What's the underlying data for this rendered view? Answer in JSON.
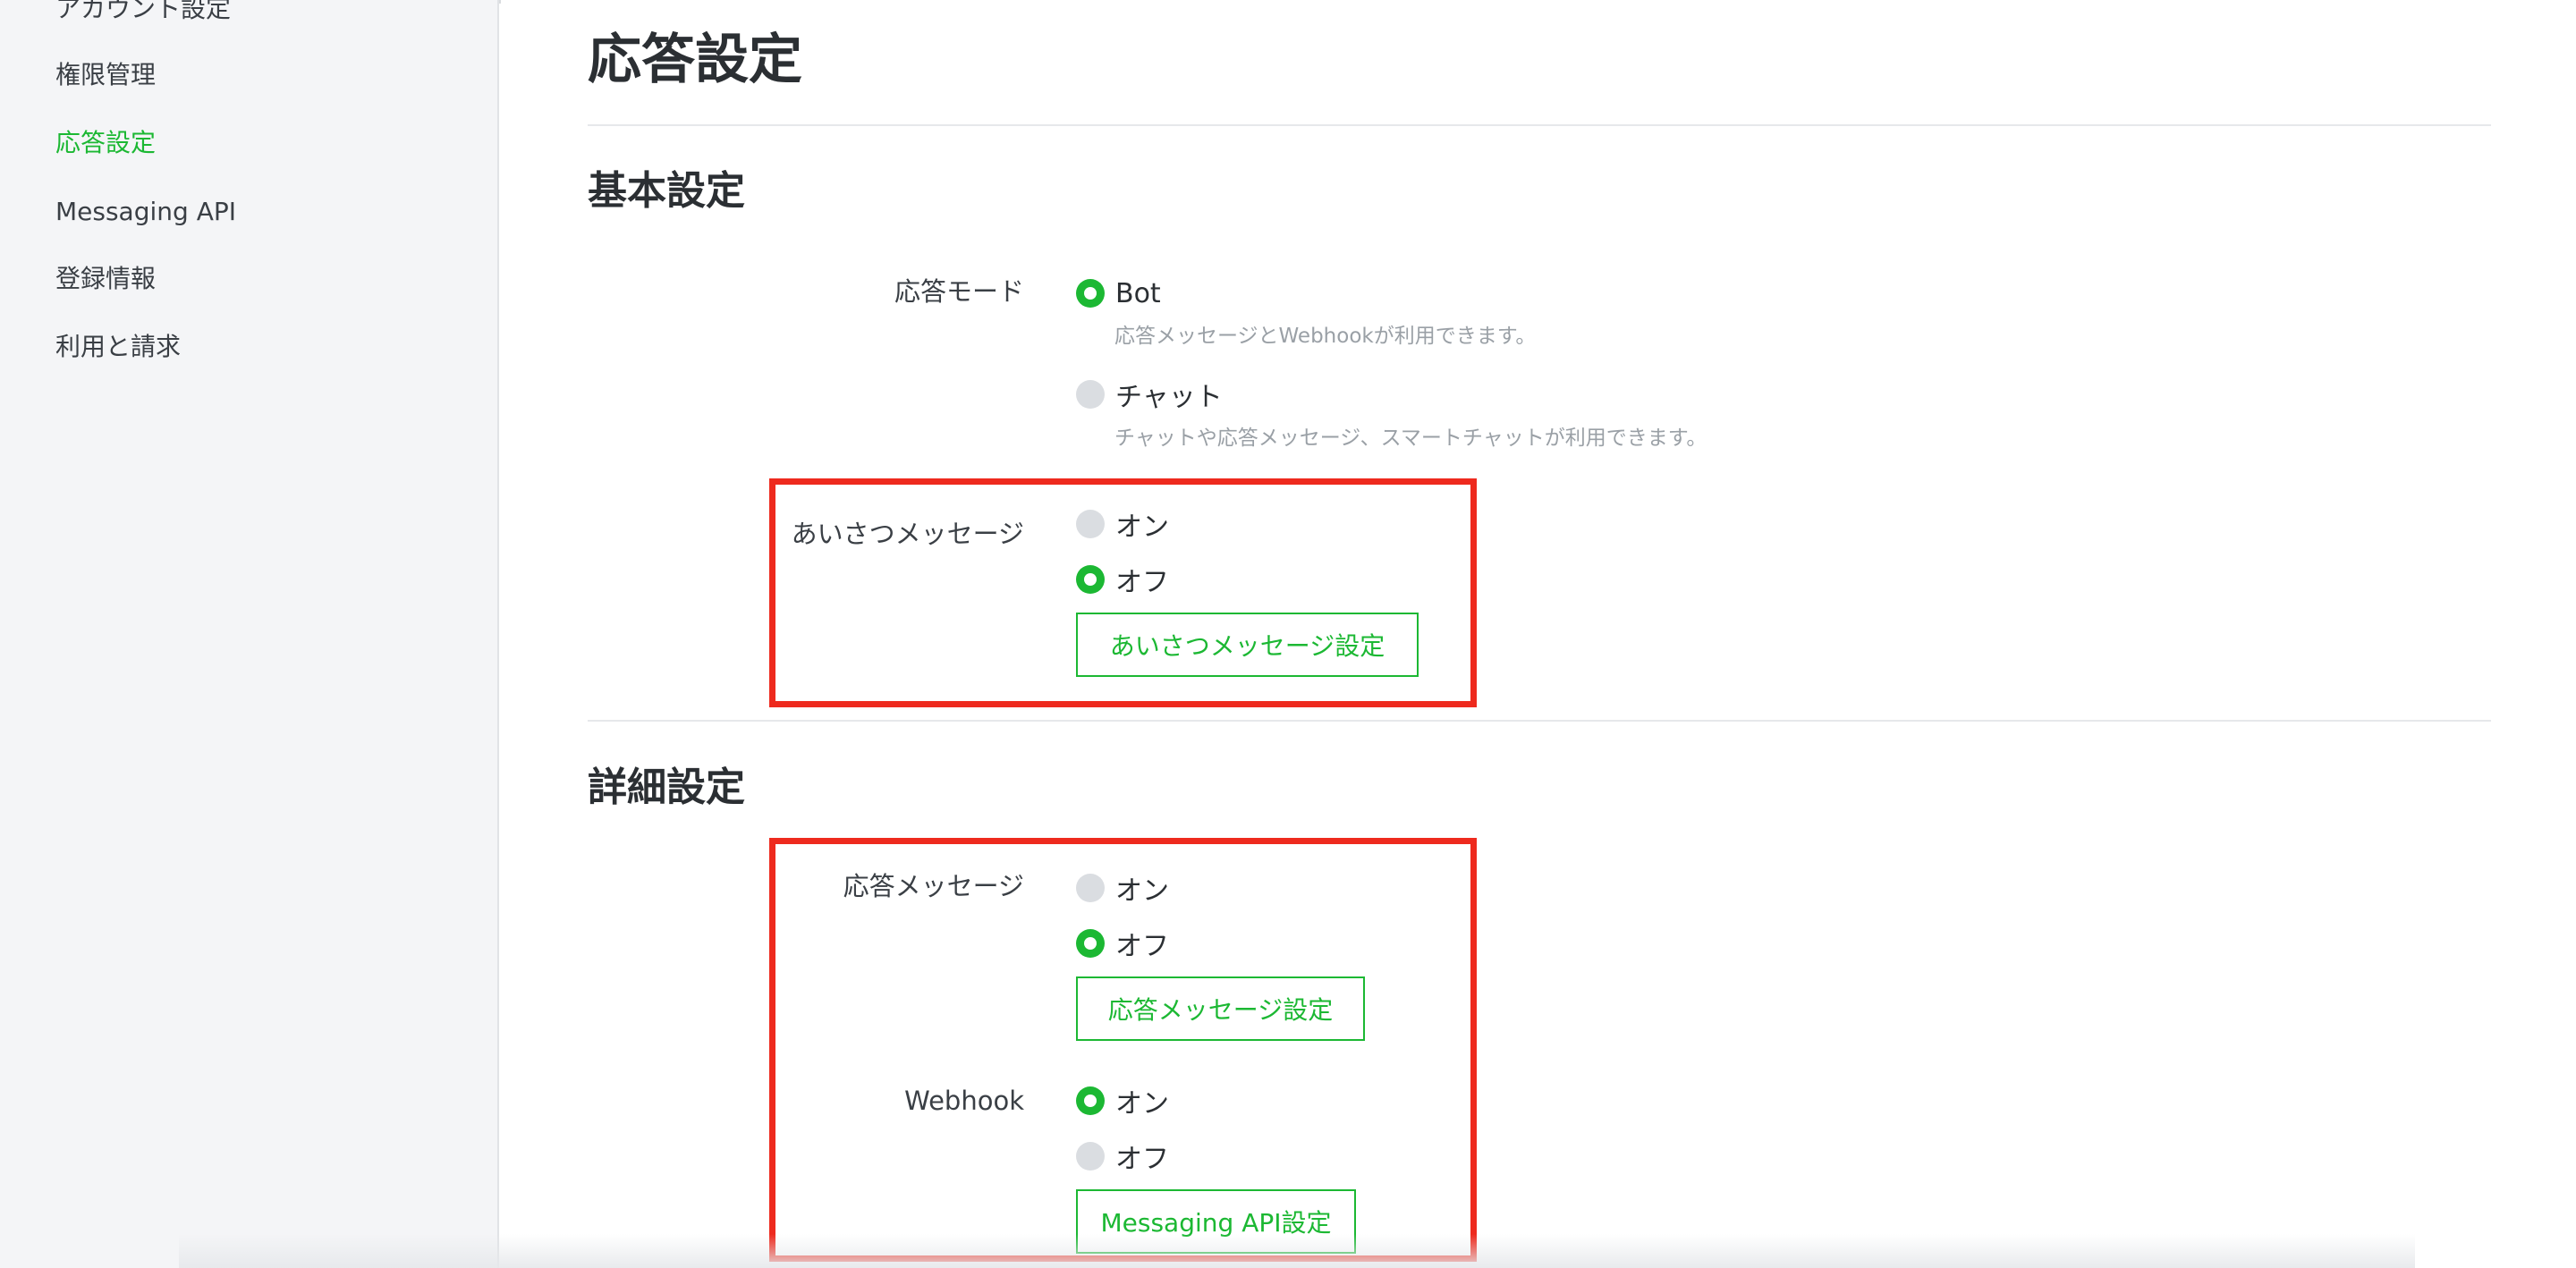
{
  "sidebar": {
    "items": [
      {
        "label": "アカウント設定",
        "active": false
      },
      {
        "label": "権限管理",
        "active": false
      },
      {
        "label": "応答設定",
        "active": true
      },
      {
        "label": "Messaging API",
        "active": false
      },
      {
        "label": "登録情報",
        "active": false
      },
      {
        "label": "利用と請求",
        "active": false
      }
    ]
  },
  "page": {
    "title": "応答設定"
  },
  "basic": {
    "title": "基本設定",
    "response_mode": {
      "label": "応答モード",
      "options": [
        {
          "label": "Bot",
          "checked": true,
          "hint": "応答メッセージとWebhookが利用できます。"
        },
        {
          "label": "チャット",
          "checked": false,
          "hint": "チャットや応答メッセージ、スマートチャットが利用できます。"
        }
      ]
    },
    "greeting": {
      "label": "あいさつメッセージ",
      "options": [
        {
          "label": "オン",
          "checked": false
        },
        {
          "label": "オフ",
          "checked": true
        }
      ],
      "button": "あいさつメッセージ設定"
    }
  },
  "advanced": {
    "title": "詳細設定",
    "auto_reply": {
      "label": "応答メッセージ",
      "options": [
        {
          "label": "オン",
          "checked": false
        },
        {
          "label": "オフ",
          "checked": true
        }
      ],
      "button": "応答メッセージ設定"
    },
    "webhook": {
      "label": "Webhook",
      "options": [
        {
          "label": "オン",
          "checked": true
        },
        {
          "label": "オフ",
          "checked": false
        }
      ],
      "button": "Messaging API設定"
    }
  },
  "colors": {
    "accent": "#1cb833",
    "highlight": "#ee2a1e",
    "sidebar_bg": "#f4f5f7"
  }
}
